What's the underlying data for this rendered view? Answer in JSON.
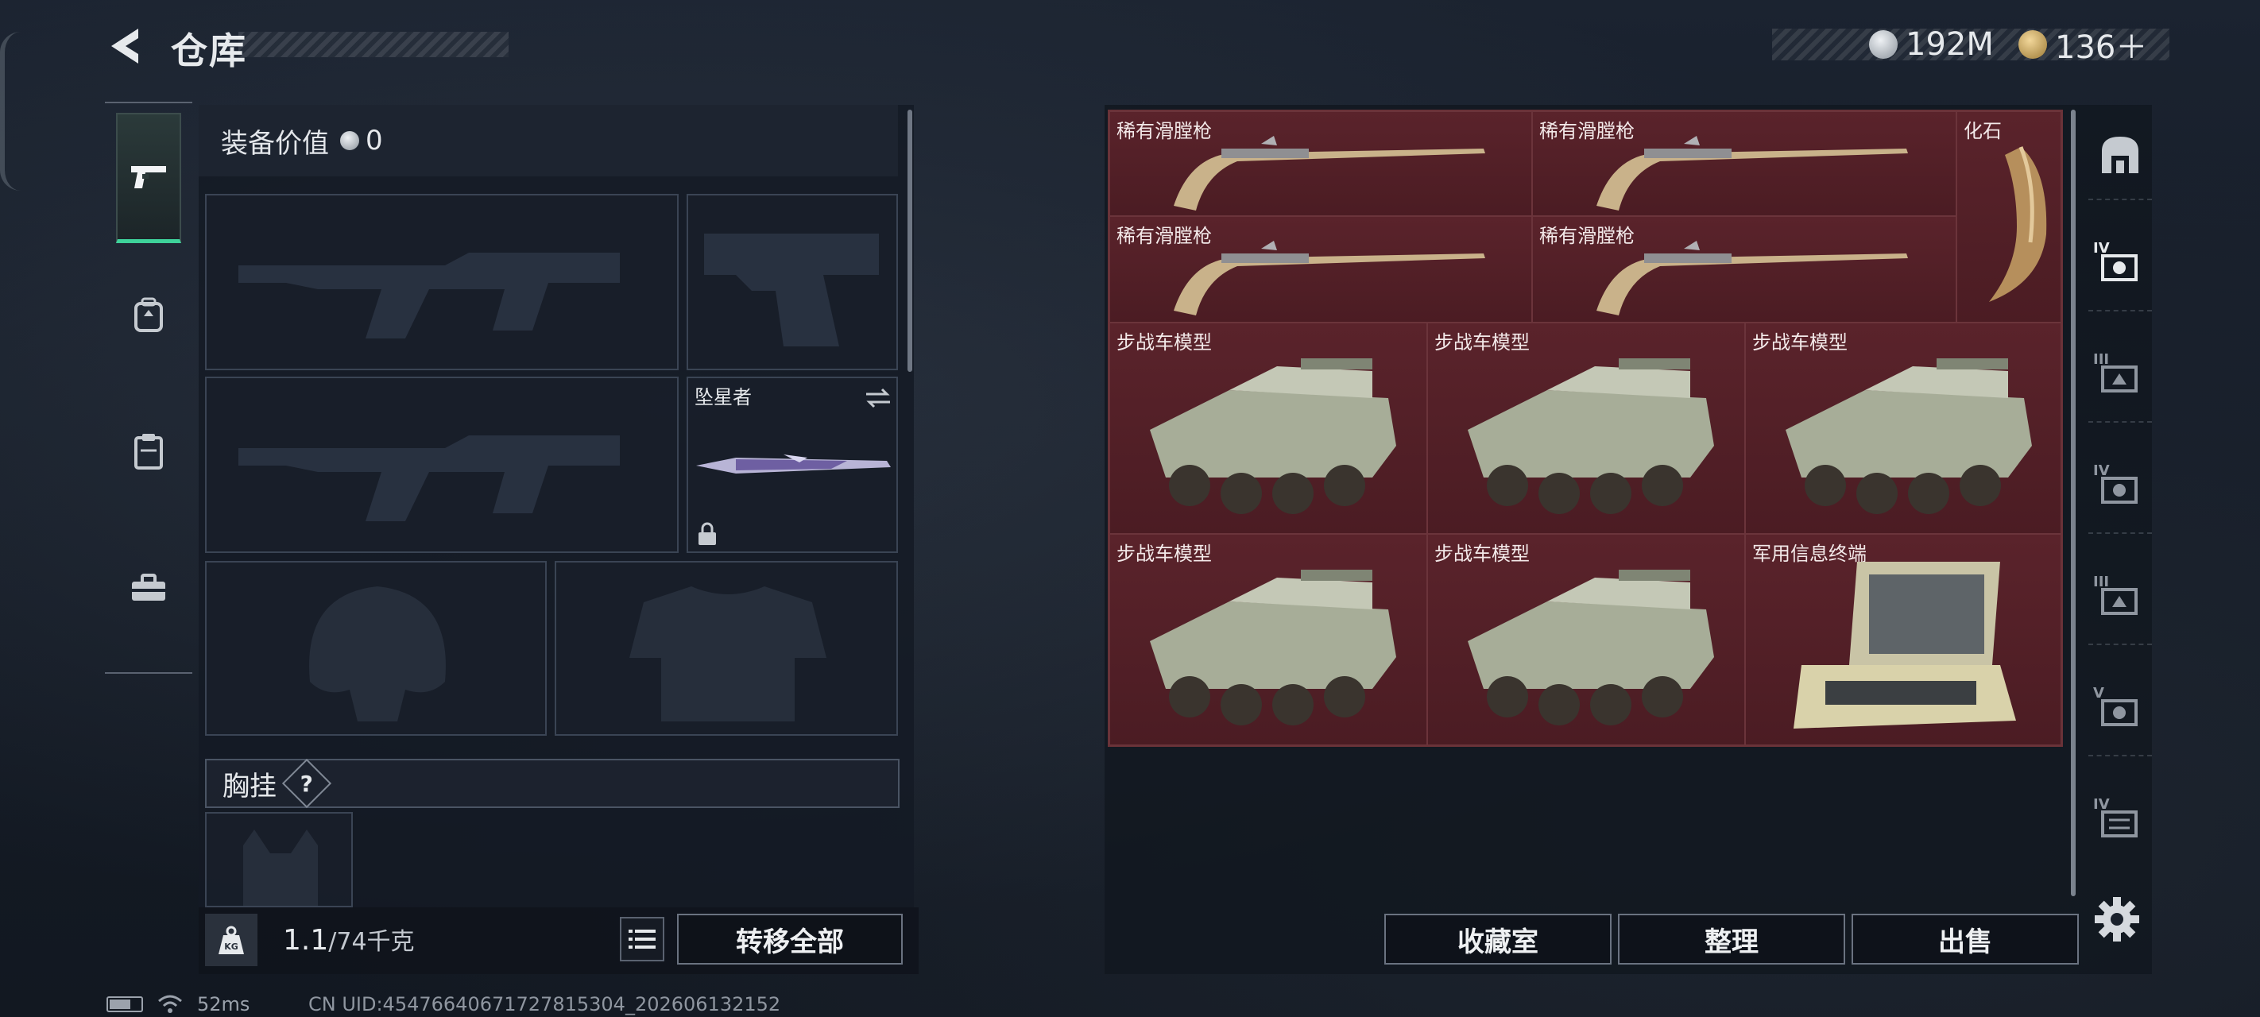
{
  "header": {
    "title": "仓库",
    "currencies": [
      {
        "icon": "silver-coin-icon",
        "value": "192M",
        "color": "#b9c0c8"
      },
      {
        "icon": "gold-coin-icon",
        "value": "136＋",
        "color": "#c9a45a"
      }
    ]
  },
  "left_tabs": [
    {
      "icon": "pistol-icon",
      "active": true
    },
    {
      "icon": "backpack-icon",
      "active": false
    },
    {
      "icon": "clipboard-icon",
      "active": false
    },
    {
      "icon": "toolbox-icon",
      "active": false
    }
  ],
  "equipment": {
    "value_label": "装备价值",
    "value": "0",
    "melee_name": "坠星者",
    "chest_label": "胸挂",
    "chest_help": "?"
  },
  "footer_left": {
    "weight_current": "1.1",
    "weight_max": "/74千克",
    "transfer_all": "转移全部"
  },
  "stash_items": [
    {
      "name": "稀有滑膛枪",
      "icon": "musket-icon"
    },
    {
      "name": "稀有滑膛枪",
      "icon": "musket-icon"
    },
    {
      "name": "化石",
      "icon": "fossil-claw-icon"
    },
    {
      "name": "稀有滑膛枪",
      "icon": "musket-icon"
    },
    {
      "name": "稀有滑膛枪",
      "icon": "musket-icon"
    },
    {
      "name": "步战车模型",
      "icon": "ifv-model-icon"
    },
    {
      "name": "步战车模型",
      "icon": "ifv-model-icon"
    },
    {
      "name": "步战车模型",
      "icon": "ifv-model-icon"
    },
    {
      "name": "步战车模型",
      "icon": "ifv-model-icon"
    },
    {
      "name": "步战车模型",
      "icon": "ifv-model-icon"
    },
    {
      "name": "军用信息终端",
      "icon": "military-terminal-icon"
    }
  ],
  "right_tabs": [
    {
      "icon": "base-icon",
      "label": ""
    },
    {
      "icon": "crate-tier-4-icon",
      "label": "IV"
    },
    {
      "icon": "crate-tier-3-icon",
      "label": "III"
    },
    {
      "icon": "crate-tier-4-icon",
      "label": "IV"
    },
    {
      "icon": "crate-tier-3-icon",
      "label": "III"
    },
    {
      "icon": "crate-tier-5-icon",
      "label": "V"
    },
    {
      "icon": "crate-tier-4-icon",
      "label": "IV"
    }
  ],
  "footer_right": {
    "collection": "收藏室",
    "organize": "整理",
    "sell": "出售"
  },
  "status": {
    "ping": "52ms",
    "uid": "CN UID:4547664067172781530​4_202606132152"
  }
}
